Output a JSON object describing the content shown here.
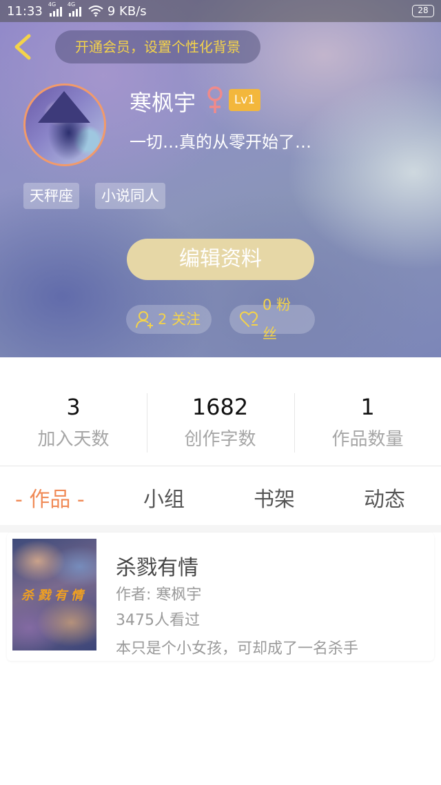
{
  "status_bar": {
    "time": "11:33",
    "network_speed": "9 KB/s",
    "battery": "28",
    "signal_label": "4G"
  },
  "header": {
    "vip_banner": "开通会员，设置个性化背景"
  },
  "profile": {
    "username": "寒枫宇",
    "gender": "female",
    "level": "Lv1",
    "signature": "一切…真的从零开始了…",
    "tags": [
      "天秤座",
      "小说同人"
    ],
    "edit_button": "编辑资料",
    "following": "2 关注",
    "fans": "0 粉丝"
  },
  "stats": [
    {
      "value": "3",
      "label": "加入天数"
    },
    {
      "value": "1682",
      "label": "创作字数"
    },
    {
      "value": "1",
      "label": "作品数量"
    }
  ],
  "tabs": {
    "works": "- 作品 -",
    "group": "小组",
    "bookshelf": "书架",
    "feed": "动态"
  },
  "works": [
    {
      "title": "杀戮有情",
      "author": "作者: 寒枫宇",
      "views": "3475人看过",
      "description": "本只是个小女孩，可却成了一名杀手",
      "cover_text": "杀戮有情"
    }
  ],
  "colors": {
    "accent": "#f08a56",
    "gold": "#f4d34a",
    "edit_button": "#e6d7a6",
    "level_badge": "#f3b73c",
    "gender_icon": "#f08a8a"
  }
}
